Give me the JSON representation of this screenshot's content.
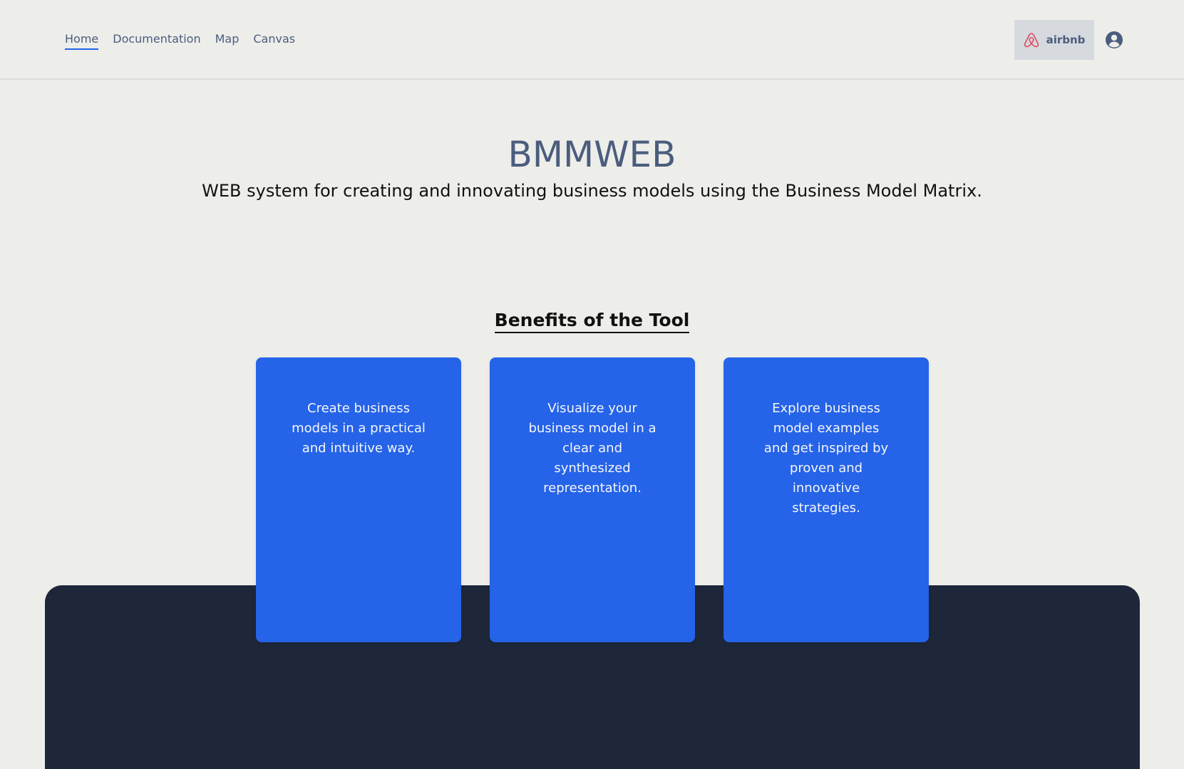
{
  "nav": {
    "items": [
      {
        "label": "Home",
        "active": true
      },
      {
        "label": "Documentation",
        "active": false
      },
      {
        "label": "Map",
        "active": false
      },
      {
        "label": "Canvas",
        "active": false
      }
    ]
  },
  "project_chip": {
    "label": "airbnb",
    "icon": "airbnb-logo-icon",
    "icon_color": "#e04a5f"
  },
  "user": {
    "icon": "user-circle-icon"
  },
  "hero": {
    "title": "BMMWEB",
    "subtitle": "WEB system for creating and innovating business models using the Business Model Matrix."
  },
  "benefits": {
    "title": "Benefits of the Tool",
    "cards": [
      {
        "text": "Create business models in a practical and intuitive way."
      },
      {
        "text": "Visualize your business model in a clear and synthesized representation."
      },
      {
        "text": "Explore business model examples and get inspired by proven and innovative strategies."
      }
    ]
  },
  "colors": {
    "background": "#ededea",
    "accent": "#2563e8",
    "footer": "#1e263a",
    "nav_text": "#4b5d7d"
  }
}
